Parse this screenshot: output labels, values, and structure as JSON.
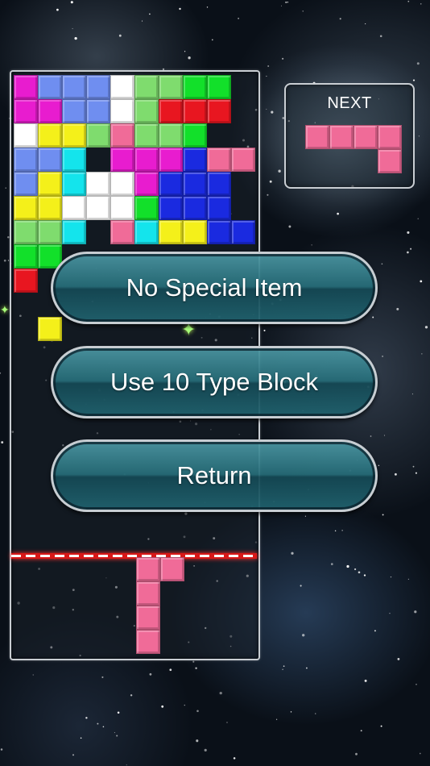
{
  "next_panel": {
    "label": "NEXT"
  },
  "menu": {
    "no_special_item": "No Special Item",
    "use_10_type_block": "Use 10 Type Block",
    "return": "Return"
  },
  "colors": {
    "magenta": "#e81ccf",
    "blue": "#6f8ef0",
    "white": "#ffffff",
    "lightgreen": "#7fdc6e",
    "green": "#12e02a",
    "red": "#e81620",
    "yellow": "#f4f01a",
    "pink": "#f06b98",
    "cyan": "#14e4ec",
    "darkblue": "#1a2ae0"
  },
  "board": {
    "rows": [
      "M B B B W L L G G .",
      "M M B B W L R R R .",
      "W Y Y L P L L G . .",
      "B B C . M M M D P P",
      "B Y C W W M D D D .",
      "Y Y W W W G D D D .",
      "L L C . P C Y Y D D",
      "G G . . . . . . . .",
      "R . . . . . . . . .",
      ". . . . . . . . . .",
      ". Y . . . . . . . ."
    ],
    "falling_piece": [
      [
        5,
        20
      ],
      [
        6,
        20
      ],
      [
        5,
        21
      ],
      [
        5,
        22
      ],
      [
        5,
        23
      ]
    ]
  },
  "next_piece": [
    [
      0,
      0
    ],
    [
      1,
      0
    ],
    [
      2,
      0
    ],
    [
      3,
      0
    ],
    [
      3,
      1
    ]
  ]
}
